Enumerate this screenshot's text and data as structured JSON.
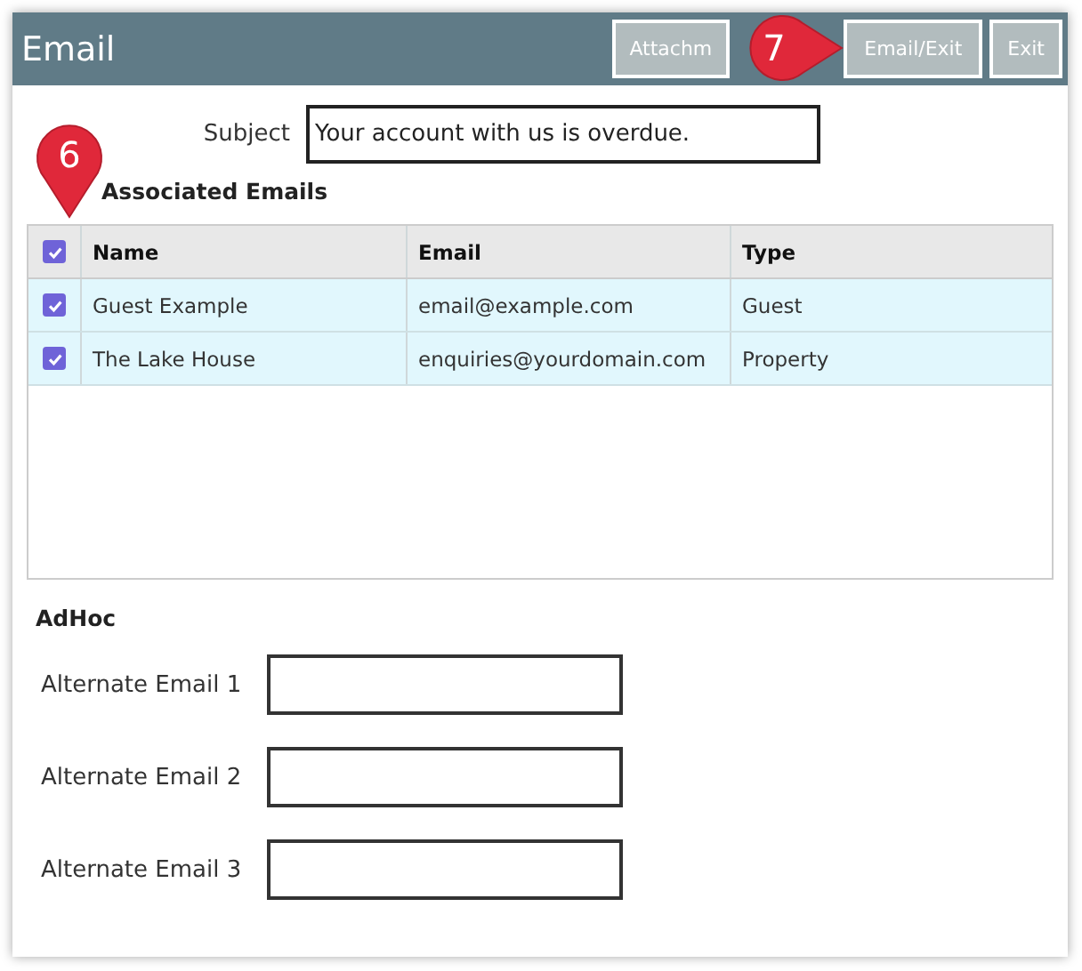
{
  "window": {
    "title": "Email"
  },
  "buttons": [
    {
      "label": "Attachm"
    },
    {
      "label": "Email/Exit"
    },
    {
      "label": "Exit"
    }
  ],
  "subject": {
    "label": "Subject",
    "value": "Your account with us is overdue."
  },
  "associated": {
    "heading": "Associated Emails",
    "all_checked": true,
    "columns": [
      "Name",
      "Email",
      "Type"
    ],
    "rows": [
      {
        "checked": true,
        "cells": [
          "Guest Example",
          "email@example.com",
          "Guest"
        ]
      },
      {
        "checked": true,
        "cells": [
          "The Lake House",
          "enquiries@yourdomain.com",
          "Property"
        ]
      }
    ]
  },
  "adhoc": {
    "heading": "AdHoc",
    "fields": [
      {
        "label": "Alternate Email 1"
      },
      {
        "label": "Alternate Email 2"
      },
      {
        "label": "Alternate Email 3"
      }
    ]
  },
  "callouts": [
    {
      "label": "6",
      "kind": "down"
    },
    {
      "label": "7",
      "kind": "right"
    }
  ]
}
